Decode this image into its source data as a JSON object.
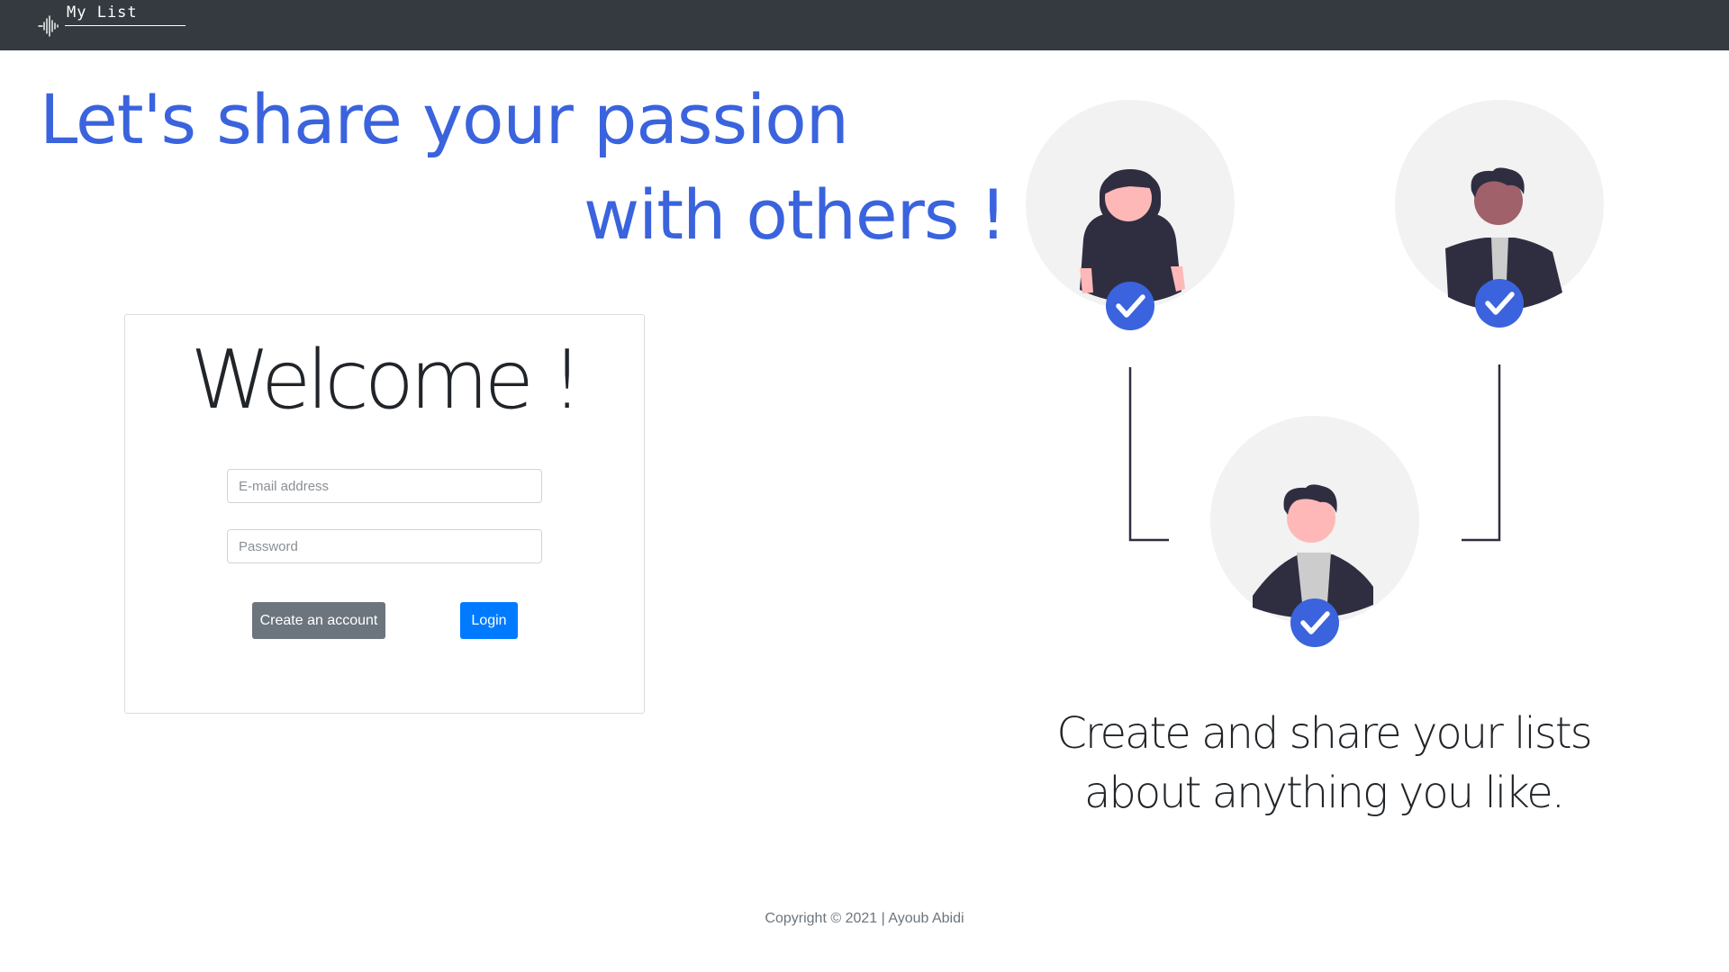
{
  "navbar": {
    "brand_text": "My List"
  },
  "hero": {
    "line1": "Let's share your passion",
    "line2": "with others !"
  },
  "login": {
    "title": "Welcome !",
    "email_placeholder": "E-mail address",
    "password_placeholder": "Password",
    "create_account_label": "Create an account",
    "login_label": "Login"
  },
  "tagline": {
    "line1": "Create and share your lists",
    "line2": "about anything you like."
  },
  "footer": {
    "copyright": "Copyright © 2021 | Ayoub Abidi"
  },
  "colors": {
    "navbar_bg": "#343a40",
    "accent_blue": "#3a63dd",
    "primary_button": "#007bff",
    "secondary_button": "#6c757d"
  },
  "icons": {
    "brand": "soundwave-icon",
    "people": [
      "person-woman-icon",
      "person-man-dark-icon",
      "person-man-icon"
    ],
    "badges": "check-circle-icon"
  }
}
